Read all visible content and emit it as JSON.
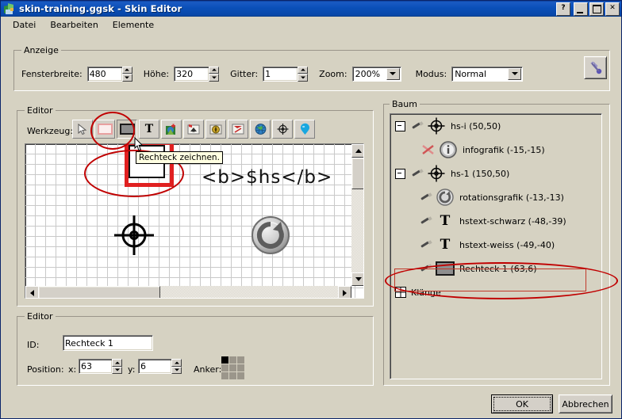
{
  "window": {
    "title": "skin-training.ggsk - Skin Editor",
    "icon": "app-icon",
    "buttons": {
      "help": "?",
      "minimize": "minimize",
      "maximize": "maximize",
      "close": "✕"
    }
  },
  "menubar": {
    "items": [
      "Datei",
      "Bearbeiten",
      "Elemente"
    ]
  },
  "anzeige": {
    "title": "Anzeige",
    "fensterbreite_label": "Fensterbreite:",
    "fensterbreite_value": "480",
    "hoehe_label": "Höhe:",
    "hoehe_value": "320",
    "gitter_label": "Gitter:",
    "gitter_value": "1",
    "zoom_label": "Zoom:",
    "zoom_value": "200%",
    "modus_label": "Modus:",
    "modus_value": "Normal",
    "tools_button": "settings-tool"
  },
  "editor_top": {
    "title": "Editor",
    "werkzeug_label": "Werkzeug:",
    "tools": [
      {
        "name": "select-arrow-tool",
        "glyph": "↖",
        "pressed": false
      },
      {
        "name": "rectangle-outline-tool",
        "glyph": "",
        "pressed": false
      },
      {
        "name": "rectangle-filled-tool",
        "glyph": "",
        "pressed": true
      },
      {
        "name": "text-tool",
        "glyph": "T",
        "pressed": false
      },
      {
        "name": "add-image-tool",
        "glyph": "",
        "pressed": false
      },
      {
        "name": "home-image-tool",
        "glyph": "",
        "pressed": false
      },
      {
        "name": "compass-image-tool",
        "glyph": "",
        "pressed": false
      },
      {
        "name": "arrow-edit-tool",
        "glyph": "",
        "pressed": false
      },
      {
        "name": "globe-tool",
        "glyph": "",
        "pressed": false
      },
      {
        "name": "crosshair-tool",
        "glyph": "",
        "pressed": false
      },
      {
        "name": "marker-tool",
        "glyph": "",
        "pressed": false
      }
    ],
    "tooltip": "Rechteck zeichnen.",
    "canvas_text": "<b>$hs</b>"
  },
  "baum": {
    "title": "Baum",
    "nodes": [
      {
        "label": "hs-i (50,50)",
        "icon": "crosshair-icon",
        "indent": 0,
        "expander": true,
        "pen": true,
        "redx": false
      },
      {
        "label": "infografik (-15,-15)",
        "icon": "info-icon",
        "indent": 1,
        "expander": false,
        "pen": false,
        "redx": true
      },
      {
        "label": "hs-1 (150,50)",
        "icon": "crosshair-icon",
        "indent": 0,
        "expander": true,
        "pen": true,
        "redx": false
      },
      {
        "label": "rotationsgrafik (-13,-13)",
        "icon": "rotation-icon",
        "indent": 1,
        "expander": false,
        "pen": true,
        "redx": false
      },
      {
        "label": "hstext-schwarz (-48,-39)",
        "icon": "text-icon",
        "indent": 1,
        "expander": false,
        "pen": true,
        "redx": false
      },
      {
        "label": "hstext-weiss (-49,-40)",
        "icon": "text-icon",
        "indent": 1,
        "expander": false,
        "pen": true,
        "redx": false
      },
      {
        "label": "Rechteck 1 (63,6)",
        "icon": "rectangle-icon",
        "indent": 1,
        "expander": false,
        "pen": true,
        "redx": false
      },
      {
        "label": "Klänge",
        "icon": "grid-icon",
        "indent": 0,
        "expander": true,
        "pen": false,
        "redx": false
      }
    ]
  },
  "editor_bottom": {
    "title": "Editor",
    "id_label": "ID:",
    "id_value": "Rechteck 1",
    "position_label": "Position:",
    "x_label": "x:",
    "x_value": "63",
    "y_label": "y:",
    "y_value": "6",
    "anker_label": "Anker:",
    "anker_selected_index": 0
  },
  "footer": {
    "ok": "OK",
    "cancel": "Abbrechen"
  },
  "colors": {
    "titlebar": "#0a4fb8",
    "face": "#d6d2c2",
    "annotation_red": "#c00000",
    "tooltip_bg": "#ffffe1"
  }
}
